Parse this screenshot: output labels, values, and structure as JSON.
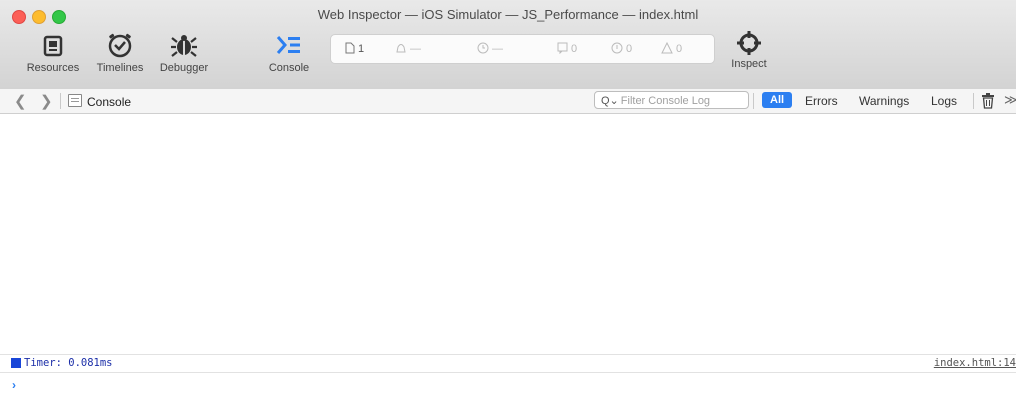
{
  "window": {
    "title": "Web Inspector — iOS Simulator — JS_Performance — index.html"
  },
  "toolbar": {
    "resources_label": "Resources",
    "timelines_label": "Timelines",
    "debugger_label": "Debugger",
    "console_label": "Console",
    "inspect_label": "Inspect"
  },
  "activity": {
    "resources_count": "1",
    "load_time": "—",
    "timeline_time": "—",
    "logs_count": "0",
    "errors_count": "0",
    "warnings_count": "0"
  },
  "navbar": {
    "breadcrumb": "Console",
    "filter_placeholder": "Filter Console Log",
    "scopes": [
      "All",
      "Errors",
      "Warnings",
      "Logs"
    ]
  },
  "console": {
    "messages": [
      {
        "text": "Timer: 0.081ms",
        "source": "index.html:14"
      }
    ],
    "prompt_symbol": "›"
  },
  "colors": {
    "accent": "#2c7ff1",
    "timer_marker": "#1946d8"
  }
}
